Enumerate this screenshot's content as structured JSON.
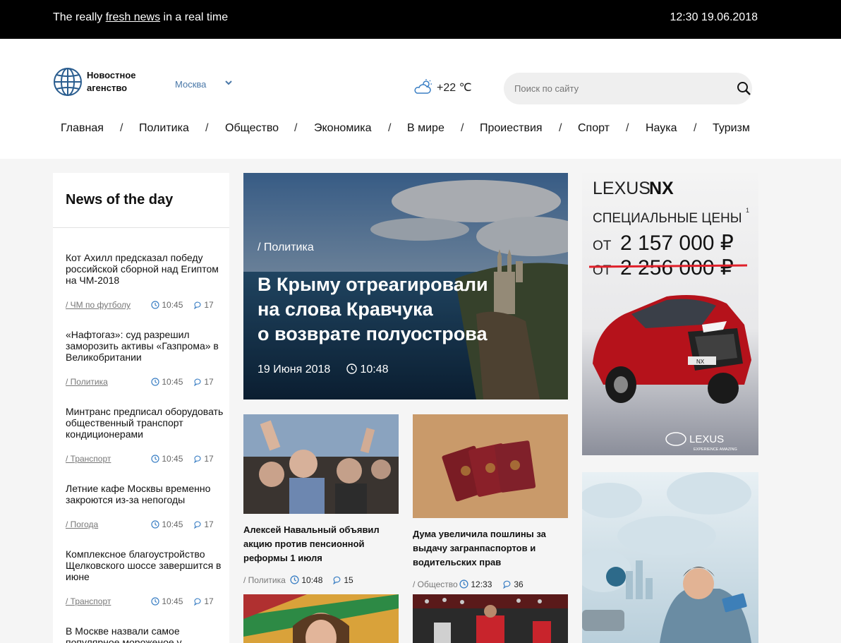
{
  "topbar": {
    "tagline_pre": "The really ",
    "tagline_link": "fresh news",
    "tagline_post": " in a real time",
    "datetime": "12:30 19.06.2018"
  },
  "header": {
    "logo_line1": "Новостное",
    "logo_line2": "агенство",
    "city": "Москва",
    "weather": "+22 ℃",
    "search_placeholder": "Поиск по сайту"
  },
  "nav": [
    "Главная",
    "Политика",
    "Общество",
    "Экономика",
    "В мире",
    "Проиествия",
    "Спорт",
    "Наука",
    "Туризм"
  ],
  "sidebar": {
    "heading": "News of the day",
    "items": [
      {
        "title": "Кот Ахилл предсказал победу российской сборной над Египтом на ЧМ-2018",
        "category": "/ ЧМ по футболу",
        "time": "10:45",
        "comments": "17"
      },
      {
        "title": "«Нафтогаз»: суд разрешил заморозить активы «Газпрома» в Великобритании",
        "category": "/ Политика",
        "time": "10:45",
        "comments": "17"
      },
      {
        "title": "Минтранс предписал оборудовать общественный транспорт кондиционерами",
        "category": "/ Транспорт",
        "time": "10:45",
        "comments": "17"
      },
      {
        "title": "Летние кафе Москвы временно закроются из-за непогоды",
        "category": "/ Погода",
        "time": "10:45",
        "comments": "17"
      },
      {
        "title": "Комплексное благоустройство Щелковского шоссе завершится в июне",
        "category": "/ Транспорт",
        "time": "10:45",
        "comments": "17"
      },
      {
        "title": "В Москве назвали самое популярное мороженое у",
        "category": "",
        "time": "",
        "comments": ""
      }
    ]
  },
  "hero": {
    "category": "/ Политика",
    "title_line1": "В Крыму отреагировали",
    "title_line2": "на слова Кравчука",
    "title_line3": "о возврате полуострова",
    "date": "19 Июня 2018",
    "time": "10:48"
  },
  "cards": [
    {
      "title_line1": "Алексей Навальный объявил",
      "title_line2": "акцию против пенсионной",
      "title_line3": "реформы 1 июля",
      "category": "/ Политика",
      "time": "10:48",
      "comments": "15"
    },
    {
      "title_line1": "Дума увеличила пошлины за",
      "title_line2": "выдачу загранпаспортов и",
      "title_line3": "водительских прав",
      "category": "/ Общество",
      "time": "12:33",
      "comments": "36"
    }
  ],
  "ad_lexus": {
    "brand": "LEXUS",
    "model": "NX",
    "headline": "СПЕЦИАЛЬНЫЕ ЦЕНЫ",
    "footnote": "1",
    "price_prefix": "ОТ",
    "price_new": "2 157 000 ₽",
    "price_old": "2 256 000 ₽",
    "plate": "NX",
    "logo_text": "LEXUS",
    "logo_sub": "EXPERIENCE AMAZING"
  },
  "colors": {
    "topbar_bg": "#000000",
    "accent_link": "#4a78a8",
    "lexus_red": "#e0202a"
  }
}
